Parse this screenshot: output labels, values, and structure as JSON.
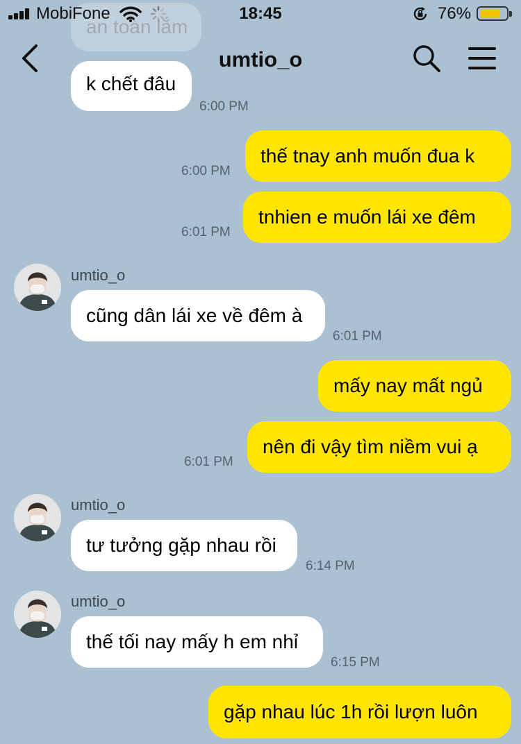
{
  "status_bar": {
    "carrier": "MobiFone",
    "time": "18:45",
    "battery_percent": "76%",
    "battery_level": 0.76,
    "battery_color": "#f4c400"
  },
  "header": {
    "title": "umtio_o",
    "back_icon": "chevron-left-icon",
    "search_icon": "search-icon",
    "menu_icon": "hamburger-menu-icon"
  },
  "colors": {
    "background": "#abc1d1",
    "outgoing_bubble": "#ffe500",
    "incoming_bubble": "#ffffff"
  },
  "messages": [
    {
      "direction": "in",
      "text": "an toàn lắm",
      "faded": true
    },
    {
      "direction": "in",
      "text": "k chết đâu",
      "time": "6:00 PM"
    },
    {
      "direction": "out",
      "text": "thế tnay anh muốn đua k",
      "time": "6:00 PM"
    },
    {
      "direction": "out",
      "text": "tnhien e muốn lái xe đêm",
      "time": "6:01 PM"
    },
    {
      "direction": "in",
      "sender": "umtio_o",
      "text": "cũng dân lái xe về đêm à",
      "time": "6:01 PM"
    },
    {
      "direction": "out",
      "text": "mấy nay mất ngủ"
    },
    {
      "direction": "out",
      "text": "nên đi vậy tìm niềm vui ạ",
      "time": "6:01 PM"
    },
    {
      "direction": "in",
      "sender": "umtio_o",
      "text": "tư tưởng gặp nhau rồi",
      "time": "6:14 PM"
    },
    {
      "direction": "in",
      "sender": "umtio_o",
      "text": "thế tối nay mấy h em nhỉ",
      "time": "6:15 PM"
    },
    {
      "direction": "out",
      "text": "gặp nhau lúc 1h rồi lượn luôn"
    }
  ]
}
